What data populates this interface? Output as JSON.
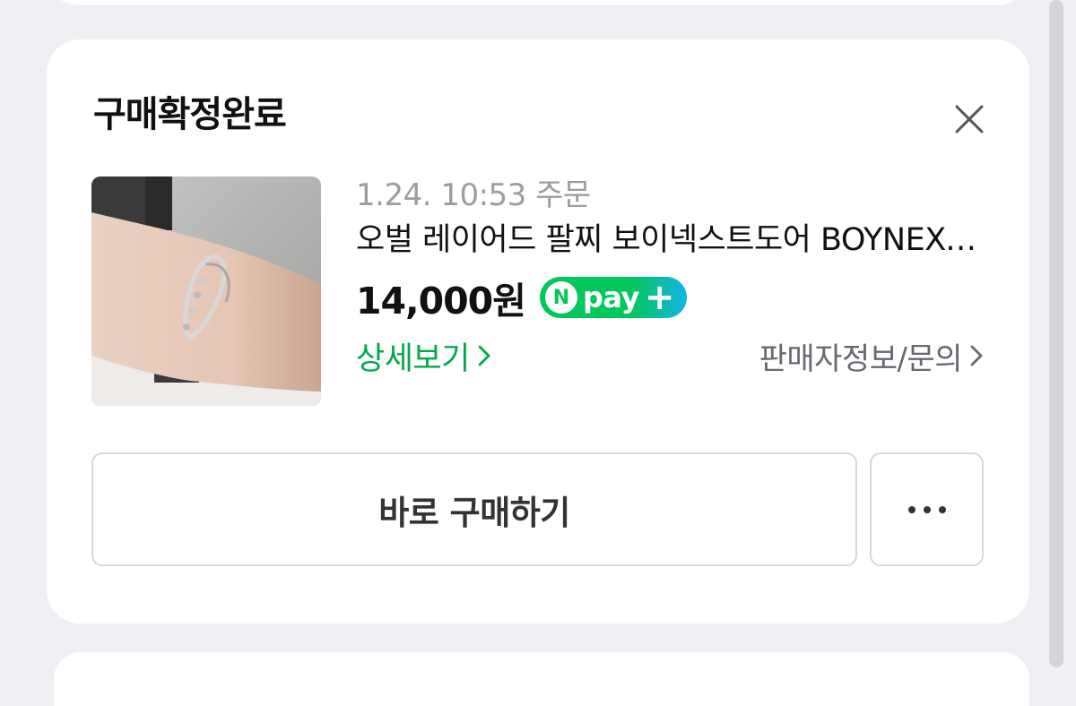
{
  "order_card": {
    "status_title": "구매확정완료",
    "close_icon": "close-icon",
    "order_time": "1.24. 10:53 주문",
    "product_title": "오벌 레이어드 팔찌 보이넥스트도어 BOYNEXTDOOR",
    "price": "14,000원",
    "npay_badge": {
      "n": "N",
      "text": "pay",
      "plus": "+",
      "colors": {
        "green": "#03c75a",
        "blue": "#14b4e6"
      }
    },
    "detail_link": "상세보기",
    "seller_link": "판매자정보/문의",
    "buy_again_button": "바로 구매하기",
    "more_button_icon": "more-horizontal-icon"
  },
  "colors": {
    "accent_green": "#03a94c",
    "muted_text": "#9a9da3",
    "background": "#eef0f4"
  }
}
